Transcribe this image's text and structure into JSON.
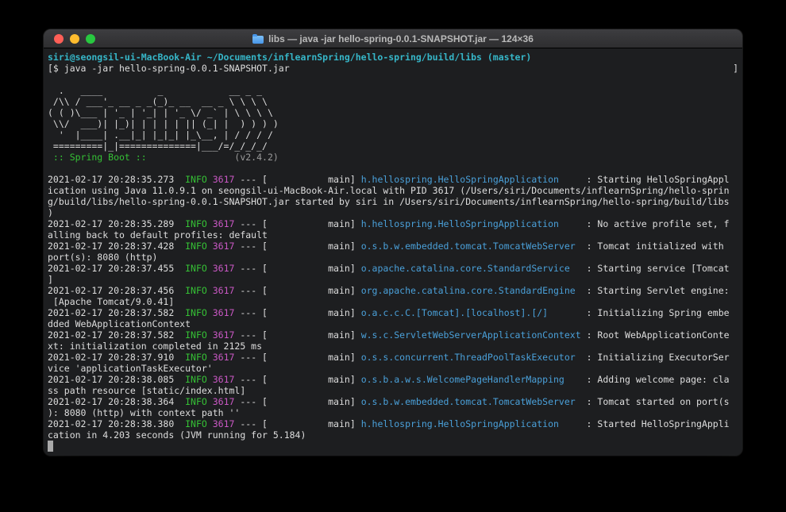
{
  "window": {
    "title": "libs — java -jar hello-spring-0.0.1-SNAPSHOT.jar — 124×36",
    "size_label": "124×36"
  },
  "colors": {
    "desktop-bg": "#000000",
    "terminal-bg": "#1d1e20",
    "titlebar-bg-top": "#3d3d40",
    "titlebar-bg-bottom": "#2e2e30",
    "titlebar-fg": "#b9b9b9",
    "default-fg": "#dedede",
    "prompt-cyan": "#36b6c8",
    "logger-blue": "#4aa0d9",
    "info-green": "#35c135",
    "pid-magenta": "#ca58c5",
    "muted-gray": "#9a9a9a",
    "close-red": "#ff5f57",
    "minimize-yellow": "#febc2e",
    "zoom-green": "#28c840",
    "cursor-gray": "#a9a9a9",
    "folder-blue": "#4795e8"
  },
  "terminal": {
    "lines": [
      [
        {
          "t": "siri@seongsil-ui-MacBook-Air ~/Documents/inflearnSpring/hello-spring/build/libs (master)",
          "c": "cyan bold"
        }
      ],
      [
        {
          "t": "[$ java -jar hello-spring-0.0.1-SNAPSHOT.jar"
        },
        {
          "t": "]",
          "c": "right"
        }
      ],
      [],
      [
        {
          "t": "  .   ____          _            __ _ _"
        }
      ],
      [
        {
          "t": " /\\\\ / ___'_ __ _ _(_)_ __  __ _ \\ \\ \\ \\"
        }
      ],
      [
        {
          "t": "( ( )\\___ | '_ | '_| | '_ \\/ _` | \\ \\ \\ \\"
        }
      ],
      [
        {
          "t": " \\\\/  ___)| |_)| | | | | || (_| |  ) ) ) )"
        }
      ],
      [
        {
          "t": "  '  |____| .__|_| |_|_| |_\\__, | / / / /"
        }
      ],
      [
        {
          "t": " =========|_|==============|___/=/_/_/_/"
        }
      ],
      [
        {
          "t": " :: Spring Boot ::",
          "c": "green"
        },
        {
          "t": "                (v2.4.2)",
          "c": "gray"
        }
      ],
      [],
      [
        {
          "t": "2021-02-17 20:28:35.273  "
        },
        {
          "t": "INFO",
          "c": "green"
        },
        {
          "t": " "
        },
        {
          "t": "3617",
          "c": "magenta"
        },
        {
          "t": " --- [           main] "
        },
        {
          "t": "h.hellospring.HelloSpringApplication",
          "c": "blue"
        },
        {
          "t": "     : Starting HelloSpringAppl"
        }
      ],
      [
        {
          "t": "ication using Java 11.0.9.1 on seongsil-ui-MacBook-Air.local with PID 3617 (/Users/siri/Documents/inflearnSpring/hello-sprin"
        }
      ],
      [
        {
          "t": "g/build/libs/hello-spring-0.0.1-SNAPSHOT.jar started by siri in /Users/siri/Documents/inflearnSpring/hello-spring/build/libs"
        }
      ],
      [
        {
          "t": ")"
        }
      ],
      [
        {
          "t": "2021-02-17 20:28:35.289  "
        },
        {
          "t": "INFO",
          "c": "green"
        },
        {
          "t": " "
        },
        {
          "t": "3617",
          "c": "magenta"
        },
        {
          "t": " --- [           main] "
        },
        {
          "t": "h.hellospring.HelloSpringApplication",
          "c": "blue"
        },
        {
          "t": "     : No active profile set, f"
        }
      ],
      [
        {
          "t": "alling back to default profiles: default"
        }
      ],
      [
        {
          "t": "2021-02-17 20:28:37.428  "
        },
        {
          "t": "INFO",
          "c": "green"
        },
        {
          "t": " "
        },
        {
          "t": "3617",
          "c": "magenta"
        },
        {
          "t": " --- [           main] "
        },
        {
          "t": "o.s.b.w.embedded.tomcat.TomcatWebServer",
          "c": "blue"
        },
        {
          "t": "  : Tomcat initialized with "
        }
      ],
      [
        {
          "t": "port(s): 8080 (http)"
        }
      ],
      [
        {
          "t": "2021-02-17 20:28:37.455  "
        },
        {
          "t": "INFO",
          "c": "green"
        },
        {
          "t": " "
        },
        {
          "t": "3617",
          "c": "magenta"
        },
        {
          "t": " --- [           main] "
        },
        {
          "t": "o.apache.catalina.core.StandardService",
          "c": "blue"
        },
        {
          "t": "   : Starting service [Tomcat"
        }
      ],
      [
        {
          "t": "]"
        }
      ],
      [
        {
          "t": "2021-02-17 20:28:37.456  "
        },
        {
          "t": "INFO",
          "c": "green"
        },
        {
          "t": " "
        },
        {
          "t": "3617",
          "c": "magenta"
        },
        {
          "t": " --- [           main] "
        },
        {
          "t": "org.apache.catalina.core.StandardEngine",
          "c": "blue"
        },
        {
          "t": "  : Starting Servlet engine:"
        }
      ],
      [
        {
          "t": " [Apache Tomcat/9.0.41]"
        }
      ],
      [
        {
          "t": "2021-02-17 20:28:37.582  "
        },
        {
          "t": "INFO",
          "c": "green"
        },
        {
          "t": " "
        },
        {
          "t": "3617",
          "c": "magenta"
        },
        {
          "t": " --- [           main] "
        },
        {
          "t": "o.a.c.c.C.[Tomcat].[localhost].[/]",
          "c": "blue"
        },
        {
          "t": "       : Initializing Spring embe"
        }
      ],
      [
        {
          "t": "dded WebApplicationContext"
        }
      ],
      [
        {
          "t": "2021-02-17 20:28:37.582  "
        },
        {
          "t": "INFO",
          "c": "green"
        },
        {
          "t": " "
        },
        {
          "t": "3617",
          "c": "magenta"
        },
        {
          "t": " --- [           main] "
        },
        {
          "t": "w.s.c.ServletWebServerApplicationContext",
          "c": "blue"
        },
        {
          "t": " : Root WebApplicationConte"
        }
      ],
      [
        {
          "t": "xt: initialization completed in 2125 ms"
        }
      ],
      [
        {
          "t": "2021-02-17 20:28:37.910  "
        },
        {
          "t": "INFO",
          "c": "green"
        },
        {
          "t": " "
        },
        {
          "t": "3617",
          "c": "magenta"
        },
        {
          "t": " --- [           main] "
        },
        {
          "t": "o.s.s.concurrent.ThreadPoolTaskExecutor",
          "c": "blue"
        },
        {
          "t": "  : Initializing ExecutorSer"
        }
      ],
      [
        {
          "t": "vice 'applicationTaskExecutor'"
        }
      ],
      [
        {
          "t": "2021-02-17 20:28:38.085  "
        },
        {
          "t": "INFO",
          "c": "green"
        },
        {
          "t": " "
        },
        {
          "t": "3617",
          "c": "magenta"
        },
        {
          "t": " --- [           main] "
        },
        {
          "t": "o.s.b.a.w.s.WelcomePageHandlerMapping",
          "c": "blue"
        },
        {
          "t": "    : Adding welcome page: cla"
        }
      ],
      [
        {
          "t": "ss path resource [static/index.html]"
        }
      ],
      [
        {
          "t": "2021-02-17 20:28:38.364  "
        },
        {
          "t": "INFO",
          "c": "green"
        },
        {
          "t": " "
        },
        {
          "t": "3617",
          "c": "magenta"
        },
        {
          "t": " --- [           main] "
        },
        {
          "t": "o.s.b.w.embedded.tomcat.TomcatWebServer",
          "c": "blue"
        },
        {
          "t": "  : Tomcat started on port(s"
        }
      ],
      [
        {
          "t": "): 8080 (http) with context path ''"
        }
      ],
      [
        {
          "t": "2021-02-17 20:28:38.380  "
        },
        {
          "t": "INFO",
          "c": "green"
        },
        {
          "t": " "
        },
        {
          "t": "3617",
          "c": "magenta"
        },
        {
          "t": " --- [           main] "
        },
        {
          "t": "h.hellospring.HelloSpringApplication",
          "c": "blue"
        },
        {
          "t": "     : Started HelloSpringAppli"
        }
      ],
      [
        {
          "t": "cation in 4.203 seconds (JVM running for 5.184)"
        }
      ],
      [
        {
          "t": " ",
          "c": "cursor"
        }
      ]
    ]
  }
}
